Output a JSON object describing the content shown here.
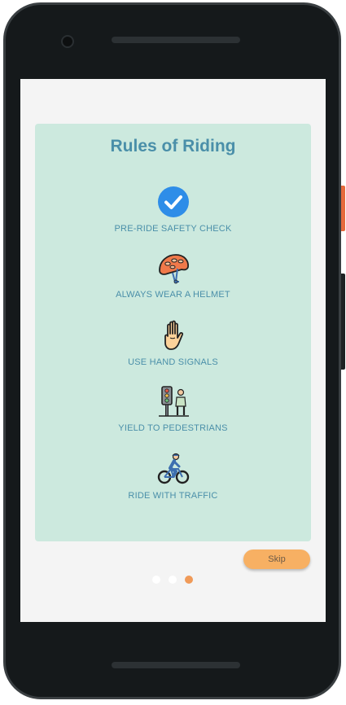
{
  "onboarding": {
    "title": "Rules of Riding",
    "rules": [
      {
        "label": "PRE-RIDE SAFETY CHECK",
        "icon": "check-circle-icon"
      },
      {
        "label": "ALWAYS WEAR A HELMET",
        "icon": "helmet-icon"
      },
      {
        "label": "USE HAND SIGNALS",
        "icon": "hand-icon"
      },
      {
        "label": "YIELD TO PEDESTRIANS",
        "icon": "traffic-light-pedestrian-icon"
      },
      {
        "label": "RIDE WITH TRAFFIC",
        "icon": "cyclist-icon"
      }
    ],
    "skip_label": "Skip",
    "pagination": {
      "total": 3,
      "active": 3
    }
  },
  "colors": {
    "card_background": "#cce9de",
    "title_color": "#4a8fa9",
    "accent_orange": "#f7b063",
    "check_blue": "#2e8de8"
  }
}
